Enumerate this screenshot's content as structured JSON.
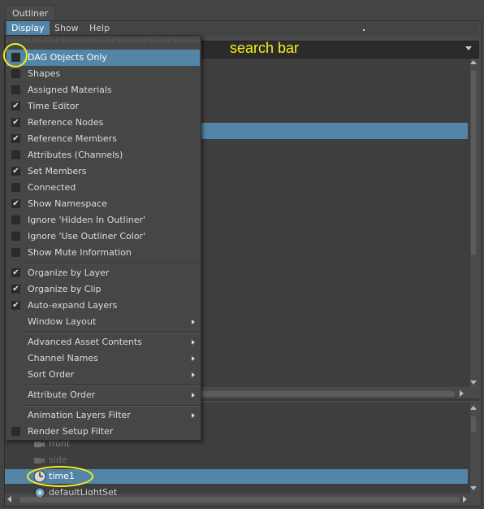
{
  "tab": {
    "label": "Outliner"
  },
  "menubar": {
    "items": [
      "Display",
      "Show",
      "Help"
    ]
  },
  "search": {
    "annotation": "search bar"
  },
  "dropdown": {
    "items": [
      {
        "label": "DAG Objects Only",
        "checked": false,
        "selected": true
      },
      {
        "label": "Shapes",
        "checked": false
      },
      {
        "label": "Assigned Materials",
        "checked": false
      },
      {
        "label": "Time Editor",
        "checked": true
      },
      {
        "label": "Reference Nodes",
        "checked": true
      },
      {
        "label": "Reference Members",
        "checked": true
      },
      {
        "label": "Attributes (Channels)",
        "checked": false
      },
      {
        "label": "Set Members",
        "checked": true
      },
      {
        "label": "Connected",
        "checked": false
      },
      {
        "label": "Show Namespace",
        "checked": true
      },
      {
        "label": "Ignore 'Hidden In Outliner'",
        "checked": false
      },
      {
        "label": "Ignore 'Use Outliner Color'",
        "checked": false
      },
      {
        "label": "Show Mute Information",
        "checked": false
      },
      {
        "label": "Organize by Layer",
        "checked": true
      },
      {
        "label": "Organize by Clip",
        "checked": true
      },
      {
        "label": "Auto-expand Layers",
        "checked": true
      },
      {
        "label": "Window Layout",
        "submenu": true
      },
      {
        "label": "Advanced Asset Contents",
        "submenu": true
      },
      {
        "label": "Channel Names",
        "submenu": true
      },
      {
        "label": "Sort Order",
        "submenu": true
      },
      {
        "label": "Attribute Order",
        "submenu": true
      },
      {
        "label": "Animation Layers Filter",
        "submenu": true
      },
      {
        "label": "Render Setup Filter",
        "checked": false
      }
    ]
  },
  "lower_list": {
    "items": [
      "front",
      "side",
      "time1",
      "defaultLightSet"
    ]
  },
  "colors": {
    "accent": "#5285a6",
    "annotation": "#f4f01a"
  }
}
